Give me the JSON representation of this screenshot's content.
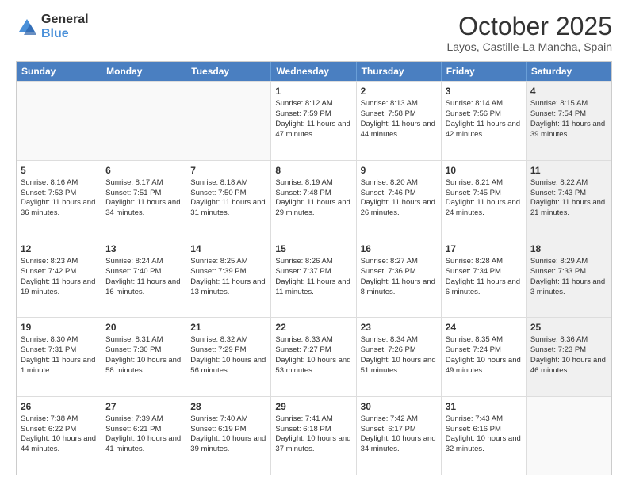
{
  "logo": {
    "general": "General",
    "blue": "Blue"
  },
  "header": {
    "month": "October 2025",
    "location": "Layos, Castille-La Mancha, Spain"
  },
  "days": [
    "Sunday",
    "Monday",
    "Tuesday",
    "Wednesday",
    "Thursday",
    "Friday",
    "Saturday"
  ],
  "weeks": [
    [
      {
        "day": "",
        "info": ""
      },
      {
        "day": "",
        "info": ""
      },
      {
        "day": "",
        "info": ""
      },
      {
        "day": "1",
        "info": "Sunrise: 8:12 AM\nSunset: 7:59 PM\nDaylight: 11 hours and 47 minutes."
      },
      {
        "day": "2",
        "info": "Sunrise: 8:13 AM\nSunset: 7:58 PM\nDaylight: 11 hours and 44 minutes."
      },
      {
        "day": "3",
        "info": "Sunrise: 8:14 AM\nSunset: 7:56 PM\nDaylight: 11 hours and 42 minutes."
      },
      {
        "day": "4",
        "info": "Sunrise: 8:15 AM\nSunset: 7:54 PM\nDaylight: 11 hours and 39 minutes."
      }
    ],
    [
      {
        "day": "5",
        "info": "Sunrise: 8:16 AM\nSunset: 7:53 PM\nDaylight: 11 hours and 36 minutes."
      },
      {
        "day": "6",
        "info": "Sunrise: 8:17 AM\nSunset: 7:51 PM\nDaylight: 11 hours and 34 minutes."
      },
      {
        "day": "7",
        "info": "Sunrise: 8:18 AM\nSunset: 7:50 PM\nDaylight: 11 hours and 31 minutes."
      },
      {
        "day": "8",
        "info": "Sunrise: 8:19 AM\nSunset: 7:48 PM\nDaylight: 11 hours and 29 minutes."
      },
      {
        "day": "9",
        "info": "Sunrise: 8:20 AM\nSunset: 7:46 PM\nDaylight: 11 hours and 26 minutes."
      },
      {
        "day": "10",
        "info": "Sunrise: 8:21 AM\nSunset: 7:45 PM\nDaylight: 11 hours and 24 minutes."
      },
      {
        "day": "11",
        "info": "Sunrise: 8:22 AM\nSunset: 7:43 PM\nDaylight: 11 hours and 21 minutes."
      }
    ],
    [
      {
        "day": "12",
        "info": "Sunrise: 8:23 AM\nSunset: 7:42 PM\nDaylight: 11 hours and 19 minutes."
      },
      {
        "day": "13",
        "info": "Sunrise: 8:24 AM\nSunset: 7:40 PM\nDaylight: 11 hours and 16 minutes."
      },
      {
        "day": "14",
        "info": "Sunrise: 8:25 AM\nSunset: 7:39 PM\nDaylight: 11 hours and 13 minutes."
      },
      {
        "day": "15",
        "info": "Sunrise: 8:26 AM\nSunset: 7:37 PM\nDaylight: 11 hours and 11 minutes."
      },
      {
        "day": "16",
        "info": "Sunrise: 8:27 AM\nSunset: 7:36 PM\nDaylight: 11 hours and 8 minutes."
      },
      {
        "day": "17",
        "info": "Sunrise: 8:28 AM\nSunset: 7:34 PM\nDaylight: 11 hours and 6 minutes."
      },
      {
        "day": "18",
        "info": "Sunrise: 8:29 AM\nSunset: 7:33 PM\nDaylight: 11 hours and 3 minutes."
      }
    ],
    [
      {
        "day": "19",
        "info": "Sunrise: 8:30 AM\nSunset: 7:31 PM\nDaylight: 11 hours and 1 minute."
      },
      {
        "day": "20",
        "info": "Sunrise: 8:31 AM\nSunset: 7:30 PM\nDaylight: 10 hours and 58 minutes."
      },
      {
        "day": "21",
        "info": "Sunrise: 8:32 AM\nSunset: 7:29 PM\nDaylight: 10 hours and 56 minutes."
      },
      {
        "day": "22",
        "info": "Sunrise: 8:33 AM\nSunset: 7:27 PM\nDaylight: 10 hours and 53 minutes."
      },
      {
        "day": "23",
        "info": "Sunrise: 8:34 AM\nSunset: 7:26 PM\nDaylight: 10 hours and 51 minutes."
      },
      {
        "day": "24",
        "info": "Sunrise: 8:35 AM\nSunset: 7:24 PM\nDaylight: 10 hours and 49 minutes."
      },
      {
        "day": "25",
        "info": "Sunrise: 8:36 AM\nSunset: 7:23 PM\nDaylight: 10 hours and 46 minutes."
      }
    ],
    [
      {
        "day": "26",
        "info": "Sunrise: 7:38 AM\nSunset: 6:22 PM\nDaylight: 10 hours and 44 minutes."
      },
      {
        "day": "27",
        "info": "Sunrise: 7:39 AM\nSunset: 6:21 PM\nDaylight: 10 hours and 41 minutes."
      },
      {
        "day": "28",
        "info": "Sunrise: 7:40 AM\nSunset: 6:19 PM\nDaylight: 10 hours and 39 minutes."
      },
      {
        "day": "29",
        "info": "Sunrise: 7:41 AM\nSunset: 6:18 PM\nDaylight: 10 hours and 37 minutes."
      },
      {
        "day": "30",
        "info": "Sunrise: 7:42 AM\nSunset: 6:17 PM\nDaylight: 10 hours and 34 minutes."
      },
      {
        "day": "31",
        "info": "Sunrise: 7:43 AM\nSunset: 6:16 PM\nDaylight: 10 hours and 32 minutes."
      },
      {
        "day": "",
        "info": ""
      }
    ]
  ]
}
